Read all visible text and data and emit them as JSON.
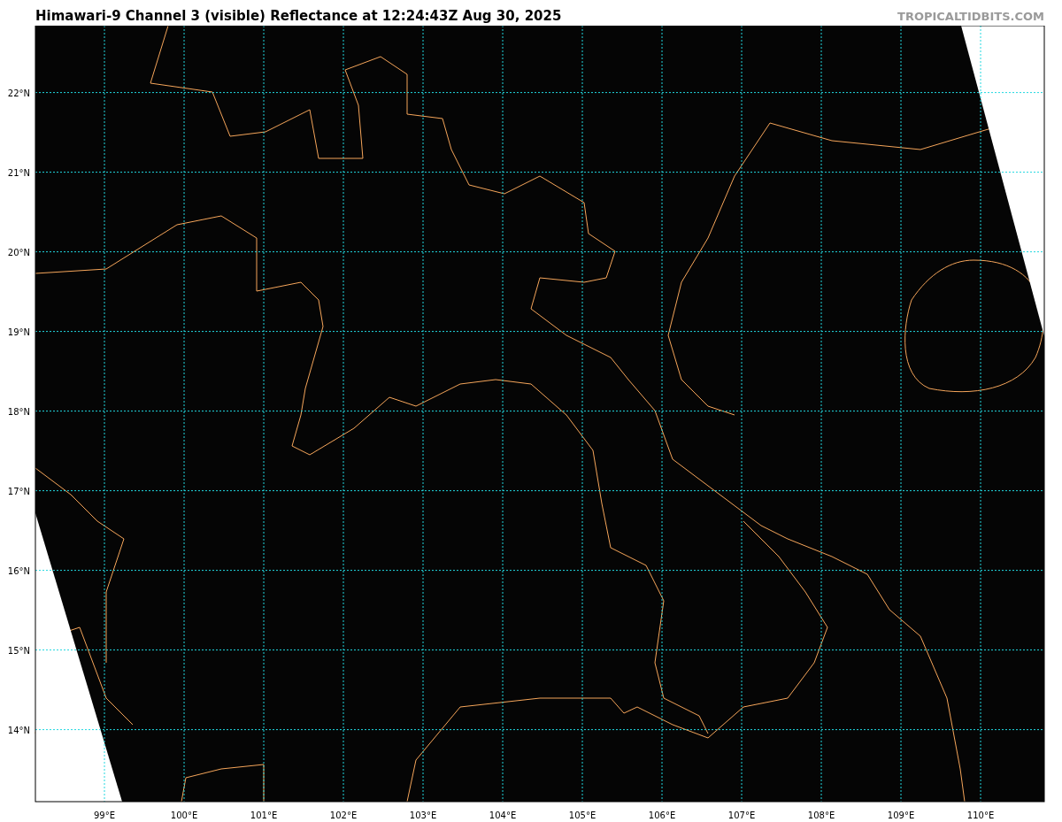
{
  "title": "Himawari-9 Channel 3 (visible) Reflectance at 12:24:43Z Aug 30, 2025",
  "credit": "TROPICALTIDBITS.COM",
  "map": {
    "x_tick_labels": [
      "99°E",
      "100°E",
      "101°E",
      "102°E",
      "103°E",
      "104°E",
      "105°E",
      "106°E",
      "107°E",
      "108°E",
      "109°E",
      "110°E"
    ],
    "y_tick_labels": [
      "22°N",
      "21°N",
      "20°N",
      "19°N",
      "18°N",
      "17°N",
      "16°N",
      "15°N",
      "14°N"
    ]
  }
}
